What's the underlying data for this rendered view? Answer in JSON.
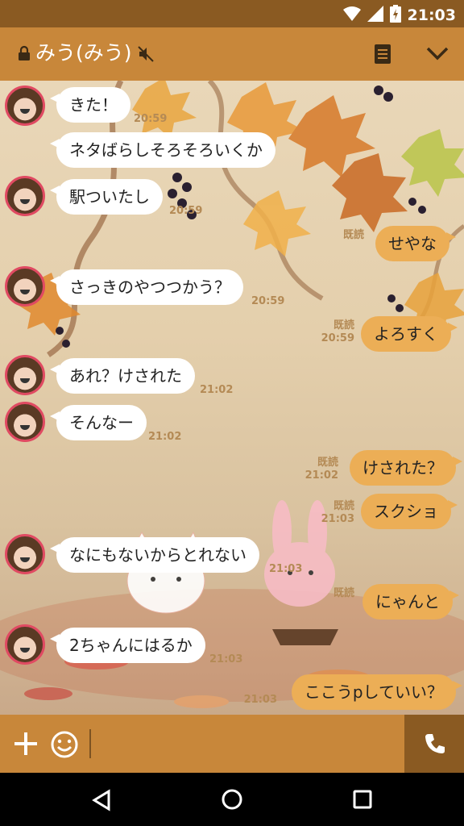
{
  "status_bar": {
    "time": "21:03"
  },
  "header": {
    "title": "みう(みう)"
  },
  "messages": [
    {
      "dir": "in",
      "text": "きた！",
      "time": "20:59"
    },
    {
      "dir": "in",
      "text": "ネタばらしそろそろいくか",
      "time": ""
    },
    {
      "dir": "in",
      "text": "駅ついたし",
      "time": "20:59"
    },
    {
      "dir": "out",
      "text": "せやな",
      "read": "既読",
      "time": ""
    },
    {
      "dir": "in",
      "text": "さっきのやつつかう？",
      "time": "20:59"
    },
    {
      "dir": "out",
      "text": "よろすく",
      "read": "既読",
      "time": "20:59"
    },
    {
      "dir": "in",
      "text": "あれ？けされた",
      "time": "21:02"
    },
    {
      "dir": "in",
      "text": "そんなー",
      "time": "21:02"
    },
    {
      "dir": "out",
      "text": "けされた？",
      "read": "既読",
      "time": "21:02"
    },
    {
      "dir": "out",
      "text": "スクショ",
      "read": "既読",
      "time": "21:03"
    },
    {
      "dir": "in",
      "text": "なにもないからとれない",
      "time": "21:03"
    },
    {
      "dir": "out",
      "text": "にゃんと",
      "read": "既読",
      "time": ""
    },
    {
      "dir": "in",
      "text": "2ちゃんにはるか",
      "time": "21:03"
    },
    {
      "dir": "out",
      "text": "ここうpしていい？",
      "read": "",
      "time": "21:03"
    }
  ],
  "icons": {
    "wifi": "wifi-icon",
    "signal": "signal-icon",
    "battery": "battery-charging-icon",
    "lock": "lock-icon",
    "mute": "mute-icon",
    "notes": "notes-icon",
    "chevron": "chevron-down-icon",
    "plus": "plus-icon",
    "emoji": "emoji-icon",
    "call": "phone-icon",
    "back": "back-icon",
    "home": "home-icon",
    "recent": "recent-apps-icon"
  },
  "colors": {
    "header": "#c8873a",
    "status_bar": "#8a5a22",
    "outgoing_bubble": "#ecae56",
    "incoming_bubble": "#ffffff",
    "avatar_ring": "#e04a62"
  }
}
